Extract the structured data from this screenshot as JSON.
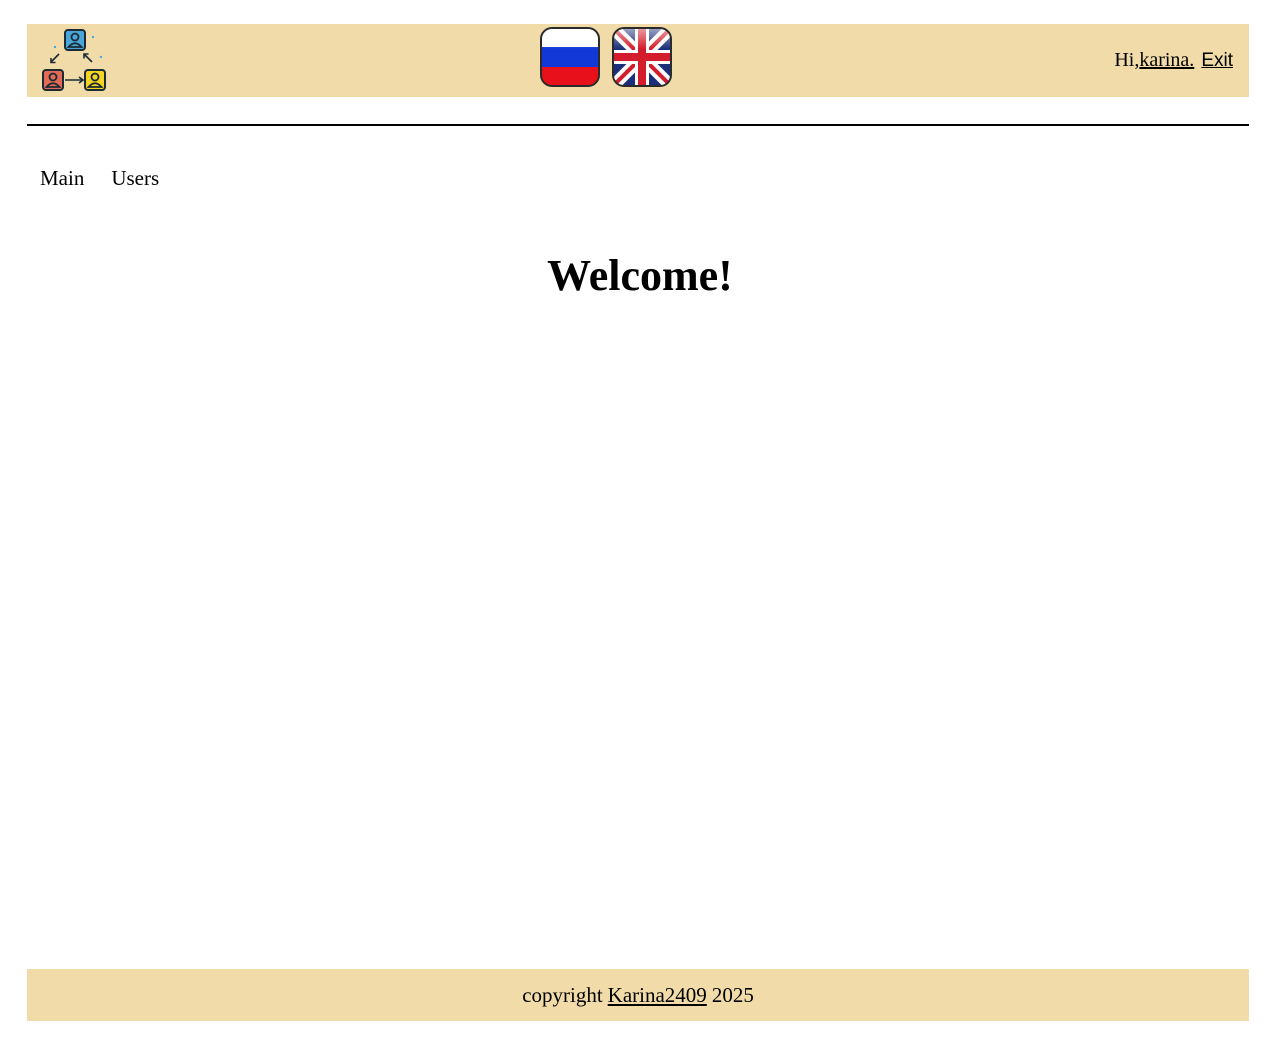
{
  "header": {
    "logo_icon": "users-exchange-logo-icon",
    "flags": [
      {
        "icon": "russia-flag-icon"
      },
      {
        "icon": "uk-flag-icon"
      }
    ],
    "greeting_prefix": "Hi,",
    "username": "karina.",
    "exit_label": "Exit"
  },
  "nav": {
    "items": [
      {
        "label": "Main"
      },
      {
        "label": "Users"
      }
    ]
  },
  "main": {
    "title": "Welcome!"
  },
  "footer": {
    "prefix": "copyright",
    "author": "Karina2409",
    "year": "2025"
  },
  "colors": {
    "header_bg": "#f1dca9",
    "footer_bg": "#f1dca9",
    "divider": "#000000"
  }
}
